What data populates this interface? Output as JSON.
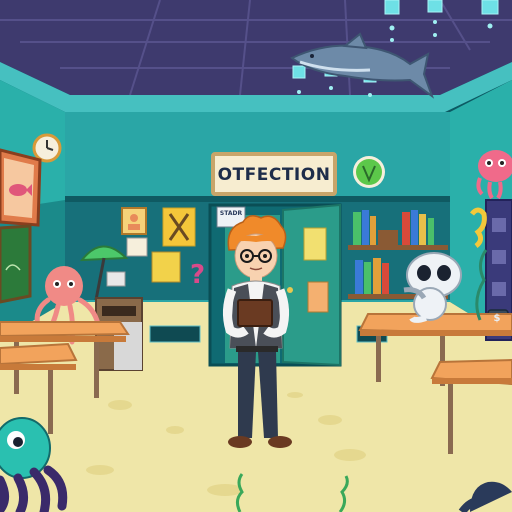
{
  "scene": {
    "sign_text": "OTFECTION",
    "poster_text": "STADR",
    "money_symbol": "$",
    "colors": {
      "ceiling": "#3e3a6e",
      "wall": "#2aa6a6",
      "wall_dark": "#17707a",
      "floor": "#efe6a8",
      "desk_top": "#f2a35c",
      "door": "#2b9c8a",
      "character_hair": "#f08a2a"
    }
  }
}
